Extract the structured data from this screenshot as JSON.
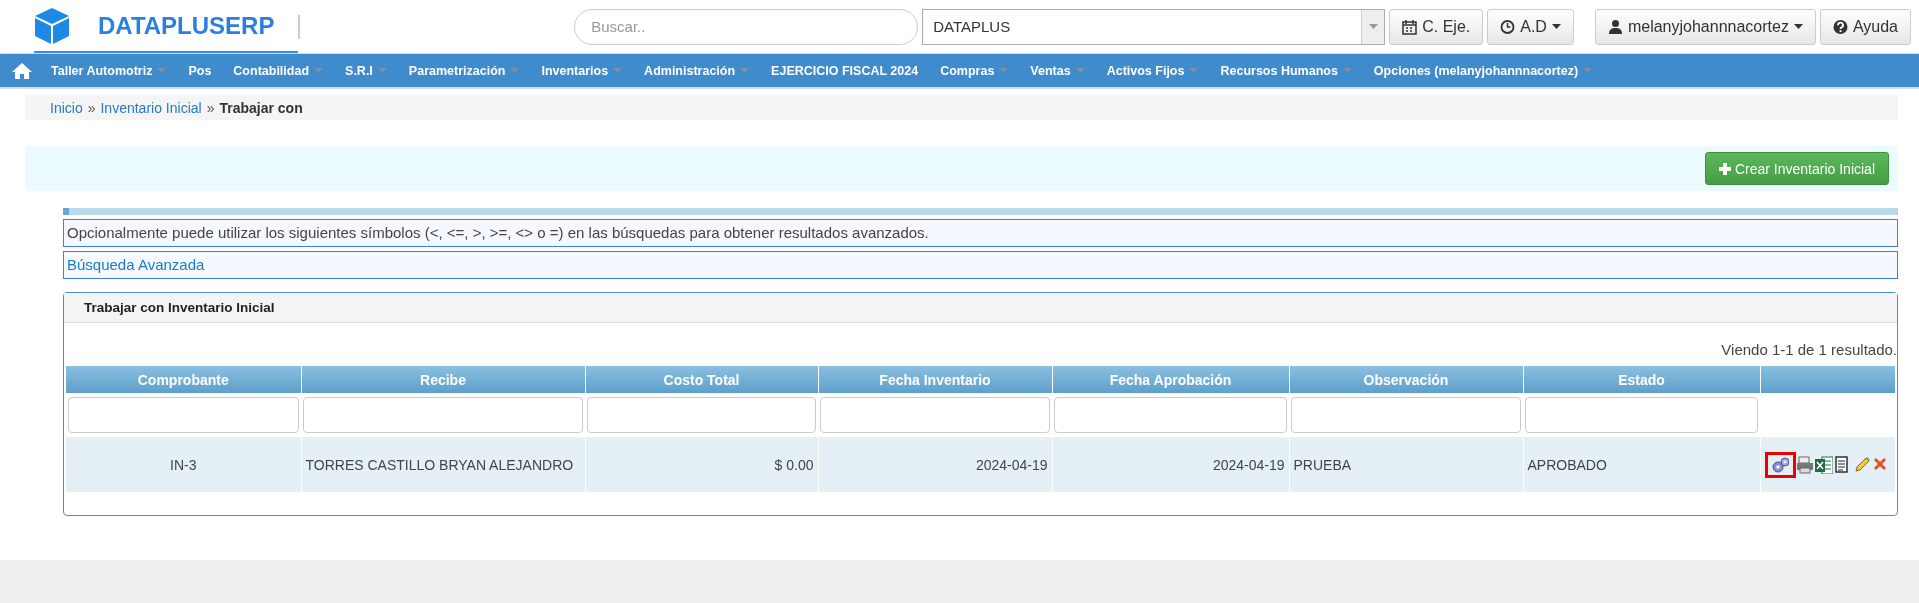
{
  "header": {
    "brand": "DATAPLUSERP",
    "search": {
      "placeholder": "Buscar.."
    },
    "company_select": {
      "value": "DATAPLUS"
    },
    "buttons": [
      {
        "kind": "calendar",
        "label": "C. Eje.",
        "dropdown": false
      },
      {
        "kind": "clock",
        "label": "A.D",
        "dropdown": true
      },
      {
        "kind": "user",
        "label": "melanyjohannnacortez",
        "dropdown": true
      },
      {
        "kind": "help",
        "label": "Ayuda",
        "dropdown": false
      }
    ]
  },
  "nav": [
    {
      "label": "Taller Automotriz",
      "has_menu": true
    },
    {
      "label": "Pos",
      "has_menu": false
    },
    {
      "label": "Contabilidad",
      "has_menu": true
    },
    {
      "label": "S.R.I",
      "has_menu": true
    },
    {
      "label": "Parametrización",
      "has_menu": true
    },
    {
      "label": "Inventarios",
      "has_menu": true
    },
    {
      "label": "Administración",
      "has_menu": true
    },
    {
      "label": "EJERCICIO FISCAL 2024",
      "has_menu": false
    },
    {
      "label": "Compras",
      "has_menu": true
    },
    {
      "label": "Ventas",
      "has_menu": true
    },
    {
      "label": "Activos Fijos",
      "has_menu": true
    },
    {
      "label": "Recursos Humanos",
      "has_menu": true
    },
    {
      "label": "Opciones (melanyjohannnacortez)",
      "has_menu": true
    }
  ],
  "breadcrumb": {
    "links": [
      "Inicio",
      "Inventario Inicial"
    ],
    "separator": "»",
    "current": "Trabajar con"
  },
  "create_button": "Crear Inventario Inicial",
  "hint": "Opcionalmente puede utilizar los siguientes símbolos (<, <=, >, >=, <> o =) en las búsquedas para obtener resultados avanzados.",
  "advanced_search": "Búsqueda Avanzada",
  "panel": {
    "title": "Trabajar con Inventario Inicial",
    "summary": "Viendo 1-1 de 1 resultado.",
    "table": {
      "columns": [
        "Comprobante",
        "Recibe",
        "Costo Total",
        "Fecha Inventario",
        "Fecha Aprobación",
        "Observación",
        "Estado"
      ],
      "rows": [
        {
          "cells": [
            "IN-3",
            "TORRES CASTILLO BRYAN ALEJANDRO",
            "$ 0.00",
            "2024-04-19",
            "2024-04-19",
            "PRUEBA",
            "APROBADO"
          ],
          "actions": [
            {
              "kind": "gears",
              "highlighted": true
            },
            {
              "kind": "print",
              "highlighted": false
            },
            {
              "kind": "excel",
              "highlighted": false
            },
            {
              "kind": "document",
              "highlighted": false
            },
            {
              "kind": "edit",
              "highlighted": false
            },
            {
              "kind": "delete",
              "highlighted": false
            }
          ]
        }
      ]
    }
  }
}
